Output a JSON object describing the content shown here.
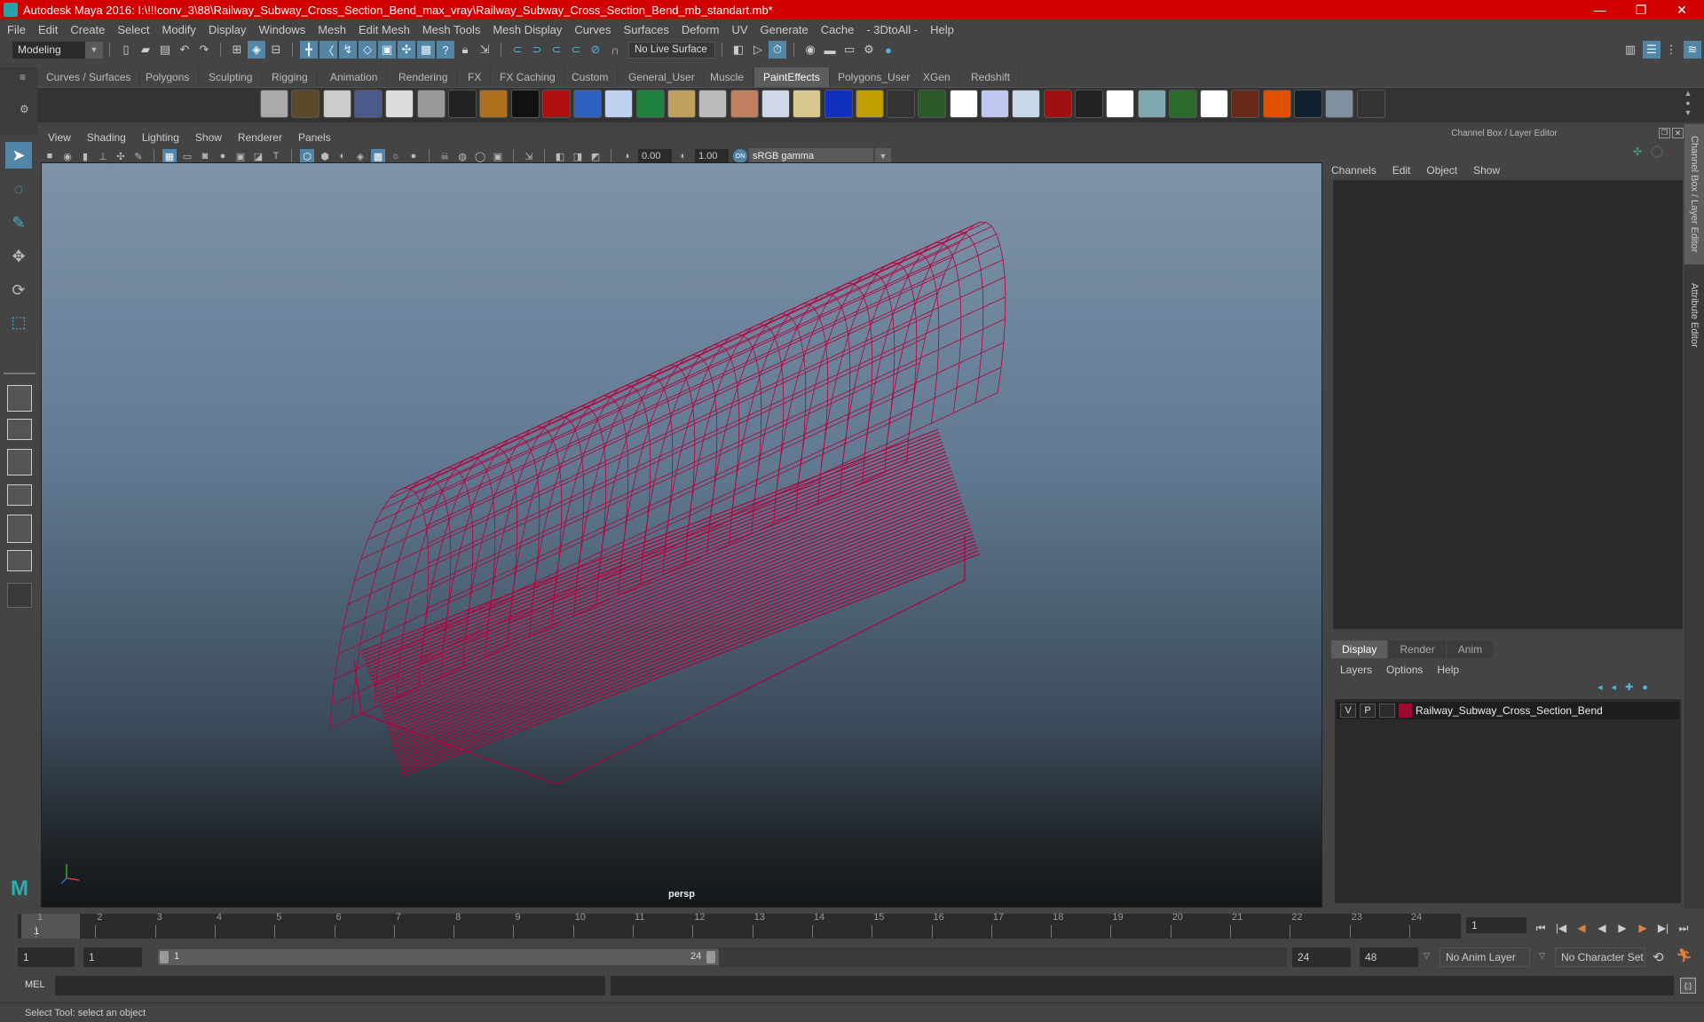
{
  "window": {
    "title": "Autodesk Maya 2016: I:\\!!!conv_3\\88\\Railway_Subway_Cross_Section_Bend_max_vray\\Railway_Subway_Cross_Section_Bend_mb_standart.mb*",
    "controls": {
      "minimize": "—",
      "maximize": "❐",
      "close": "✕"
    }
  },
  "menubar": [
    "File",
    "Edit",
    "Create",
    "Select",
    "Modify",
    "Display",
    "Windows",
    "Mesh",
    "Edit Mesh",
    "Mesh Tools",
    "Mesh Display",
    "Curves",
    "Surfaces",
    "Deform",
    "UV",
    "Generate",
    "Cache",
    "- 3DtoAll -",
    "Help"
  ],
  "statusline": {
    "mode": "Modeling",
    "live_surface": "No Live Surface"
  },
  "shelf": {
    "tabs": [
      "Curves / Surfaces",
      "Polygons",
      "Sculpting",
      "Rigging",
      "Animation",
      "Rendering",
      "FX",
      "FX Caching",
      "Custom",
      "General_User",
      "Muscle",
      "PaintEffects",
      "Polygons_User",
      "XGen",
      "Redshift"
    ],
    "active_tab": "PaintEffects",
    "icons": [
      "brush-icon",
      "paint-tubes-icon",
      "bucket-icon",
      "template-brush-icon",
      "brush-orange-icon",
      "brush-blue-icon",
      "brush-cyan-icon",
      "teapot-icon",
      "grass-icon",
      "bubbles-icon",
      "flowers-icon",
      "lightbulb-icon",
      "hammer-icon",
      "charcoal-icon",
      "wood-icon",
      "ink-icon",
      "red-paint-icon",
      "blue-strokes-icon",
      "dots-icon",
      "rainbow-icon",
      "gold-icon",
      "hair-icon",
      "rope-icon",
      "feather-icon",
      "shell-icon",
      "blue-h-icon",
      "spiral-icon",
      "dark-fur-icon",
      "grass-plant-icon",
      "tree-red-icon",
      "flower-white-icon",
      "tree-icon",
      "red-feather-icon",
      "sparkle-icon",
      "confetti-icon",
      "water-drops-icon",
      "snake-skin-icon",
      "hand-icon",
      "meat-icon",
      "fire-icon",
      "lightning-icon",
      "clouds-icon",
      "noise-icon"
    ]
  },
  "viewport": {
    "menu": [
      "View",
      "Shading",
      "Lighting",
      "Show",
      "Renderer",
      "Panels"
    ],
    "exposure": "0.00",
    "gamma": "1.00",
    "color_space": "sRGB gamma",
    "camera_label": "persp",
    "wire_color": "#b5003a"
  },
  "channel_box": {
    "header": "Channel Box / Layer Editor",
    "menu": [
      "Channels",
      "Edit",
      "Object",
      "Show"
    ]
  },
  "layer_editor": {
    "tabs": [
      "Display",
      "Render",
      "Anim"
    ],
    "active_tab": "Display",
    "menu": [
      "Layers",
      "Options",
      "Help"
    ],
    "layers": [
      {
        "visible": "V",
        "playback": "P",
        "color": "#9b0a2e",
        "name": "Railway_Subway_Cross_Section_Bend"
      }
    ]
  },
  "side_tabs": [
    "Channel Box / Layer Editor",
    "Attribute Editor"
  ],
  "timeline": {
    "ticks": [
      "1",
      "2",
      "3",
      "4",
      "5",
      "6",
      "7",
      "8",
      "9",
      "10",
      "11",
      "12",
      "13",
      "14",
      "15",
      "16",
      "17",
      "18",
      "19",
      "20",
      "21",
      "22",
      "23",
      "24"
    ],
    "current_frame_marker": "1",
    "current_frame": "1"
  },
  "range": {
    "start": "1",
    "playback_start": "1",
    "slider_start": "1",
    "slider_end": "24",
    "playback_end": "24",
    "end": "48",
    "anim_layer": "No Anim Layer",
    "character_set": "No Character Set"
  },
  "command": {
    "label": "MEL"
  },
  "help_line": "Select Tool: select an object"
}
